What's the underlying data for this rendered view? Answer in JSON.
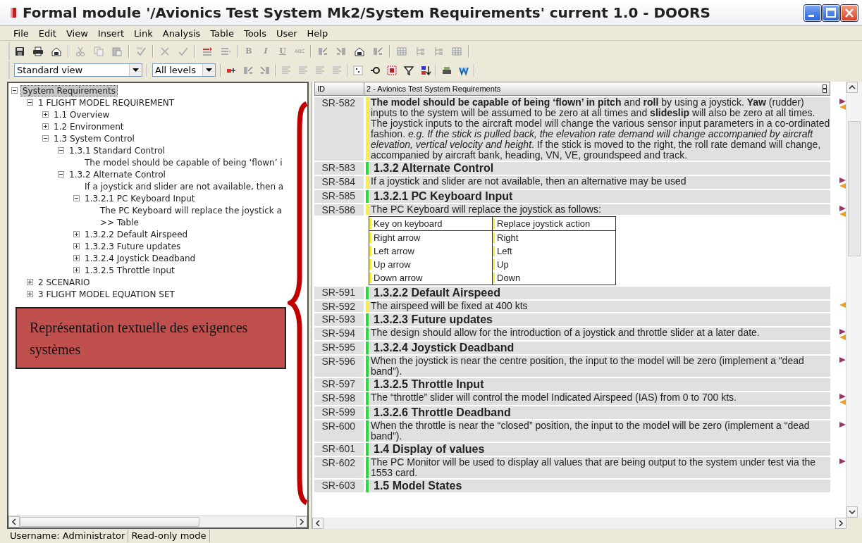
{
  "window": {
    "title": "Formal module '/Avionics Test System Mk2/System Requirements' current 1.0 - DOORS"
  },
  "menu": [
    "File",
    "Edit",
    "View",
    "Insert",
    "Link",
    "Analysis",
    "Table",
    "Tools",
    "User",
    "Help"
  ],
  "toolbar": {
    "format_buttons": [
      "B",
      "I",
      "U",
      "ABC"
    ],
    "view_select": "Standard view",
    "level_select": "All levels"
  },
  "tree": [
    {
      "label": "System Requirements",
      "selected": true,
      "expanded": true,
      "children": [
        {
          "label": "1 FLIGHT MODEL REQUIREMENT",
          "selected": false,
          "expanded": true,
          "children": [
            {
              "label": "1.1 Overview",
              "selected": false,
              "expanded": false
            },
            {
              "label": "1.2 Environment",
              "selected": false,
              "expanded": false
            },
            {
              "label": "1.3 System Control",
              "selected": false,
              "expanded": true,
              "children": [
                {
                  "label": "1.3.1 Standard Control",
                  "selected": false,
                  "expanded": true,
                  "children": [
                    {
                      "label": "The model should be capable of being ‘flown’ i",
                      "selected": false
                    }
                  ]
                },
                {
                  "label": "1.3.2 Alternate Control",
                  "selected": false,
                  "expanded": true,
                  "children": [
                    {
                      "label": "If a joystick and slider are not available, then a",
                      "selected": false
                    },
                    {
                      "label": "1.3.2.1 PC Keyboard Input",
                      "selected": false,
                      "expanded": true,
                      "children": [
                        {
                          "label": "The PC Keyboard will replace the joystick a",
                          "selected": false
                        },
                        {
                          "label": ">> Table",
                          "selected": false
                        }
                      ]
                    },
                    {
                      "label": "1.3.2.2 Default Airspeed",
                      "selected": false,
                      "expanded": false
                    },
                    {
                      "label": "1.3.2.3 Future updates",
                      "selected": false,
                      "expanded": false
                    },
                    {
                      "label": "1.3.2.4 Joystick Deadband",
                      "selected": false,
                      "expanded": false
                    },
                    {
                      "label": "1.3.2.5 Throttle Input",
                      "selected": false,
                      "expanded": false
                    }
                  ]
                }
              ]
            }
          ]
        },
        {
          "label": "2 SCENARIO",
          "selected": false,
          "expanded": false
        },
        {
          "label": "3 FLIGHT MODEL EQUATION SET",
          "selected": false,
          "expanded": false
        }
      ]
    }
  ],
  "annotation": {
    "text": "Représentation textuelle des exigences systèmes"
  },
  "table": {
    "columns": [
      "ID",
      "2 - Avionics Test System Requirements"
    ],
    "rows": [
      {
        "id": "SR-582",
        "kind": "text",
        "color": "#f4f040",
        "out_link": true,
        "in_link": true,
        "text": "**The model should be capable of being ‘flown’ in pitch** and **roll** by using a joystick. **Yaw** (rudder) inputs to the system will be assumed to be zero at all times and **slideslip** will also be zero at all times. The joystick inputs to the aircraft model will change the various sensor input parameters in a co-ordinated fashion. *e.g. If the stick is pulled back, the elevation rate demand will change accompanied by aircraft elevation, vertical velocity and height*. If the stick is moved to the right, the roll rate demand will change, accompanied by aircraft bank, heading, VN, VE, groundspeed and track."
      },
      {
        "id": "SR-583",
        "kind": "heading",
        "color": "#30d840",
        "out_link": false,
        "in_link": false,
        "text": "1.3.2 Alternate Control"
      },
      {
        "id": "SR-584",
        "kind": "text",
        "color": "#f4f040",
        "out_link": true,
        "in_link": true,
        "text": "If a joystick and slider are not available, then an alternative may be used"
      },
      {
        "id": "SR-585",
        "kind": "heading",
        "color": "#30d840",
        "out_link": false,
        "in_link": false,
        "text": "1.3.2.1 PC Keyboard Input"
      },
      {
        "id": "SR-586",
        "kind": "table",
        "color": "#f4f040",
        "out_link": true,
        "in_link": true,
        "text": "The PC Keyboard will replace the joystick as follows:",
        "columns": [
          "Key on keyboard",
          "Replace joystick action"
        ],
        "cells": [
          [
            "Right arrow",
            "Right"
          ],
          [
            "Left arrow",
            "Left"
          ],
          [
            "Up arrow",
            "Up"
          ],
          [
            "Down arrow",
            "Down"
          ]
        ]
      },
      {
        "id": "SR-591",
        "kind": "heading",
        "color": "#30d840",
        "out_link": false,
        "in_link": false,
        "text": "1.3.2.2 Default Airspeed"
      },
      {
        "id": "SR-592",
        "kind": "text",
        "color": "#f4f040",
        "out_link": false,
        "in_link": true,
        "text": "The airspeed will be fixed at 400 kts"
      },
      {
        "id": "SR-593",
        "kind": "heading",
        "color": "#30d840",
        "out_link": false,
        "in_link": false,
        "text": "1.3.2.3 Future updates"
      },
      {
        "id": "SR-594",
        "kind": "text",
        "color": "#30d840",
        "out_link": true,
        "in_link": true,
        "text": "The design should allow for the introduction of a joystick and throttle slider at a later date."
      },
      {
        "id": "SR-595",
        "kind": "heading",
        "color": "#30d840",
        "out_link": false,
        "in_link": false,
        "text": "1.3.2.4 Joystick Deadband"
      },
      {
        "id": "SR-596",
        "kind": "text",
        "color": "#30d840",
        "out_link": true,
        "in_link": false,
        "text": "When the joystick is near the centre position, the input to the model will be zero (implement a “dead band”)."
      },
      {
        "id": "SR-597",
        "kind": "heading",
        "color": "#30d840",
        "out_link": false,
        "in_link": false,
        "text": "1.3.2.5 Throttle Input"
      },
      {
        "id": "SR-598",
        "kind": "text",
        "color": "#30d840",
        "out_link": true,
        "in_link": true,
        "text": "The “throttle” slider will control the model Indicated Airspeed (IAS) from 0 to 700 kts."
      },
      {
        "id": "SR-599",
        "kind": "heading",
        "color": "#30d840",
        "out_link": false,
        "in_link": false,
        "text": "1.3.2.6 Throttle Deadband"
      },
      {
        "id": "SR-600",
        "kind": "text",
        "color": "#30d840",
        "out_link": true,
        "in_link": false,
        "text": "When the throttle is near the “closed” position, the input to the model will be zero (implement a “dead band”)."
      },
      {
        "id": "SR-601",
        "kind": "heading",
        "color": "#30d840",
        "out_link": false,
        "in_link": false,
        "text": "1.4 Display of values"
      },
      {
        "id": "SR-602",
        "kind": "text",
        "color": "#30d840",
        "out_link": true,
        "in_link": false,
        "text": "The PC Monitor will be used to display all values that are being output to the system under test via the 1553 card."
      },
      {
        "id": "SR-603",
        "kind": "heading",
        "color": "#30d840",
        "out_link": false,
        "in_link": false,
        "text": "1.5 Model States"
      }
    ]
  },
  "status_bar": [
    "Username: Administrator",
    "Read-only mode"
  ]
}
